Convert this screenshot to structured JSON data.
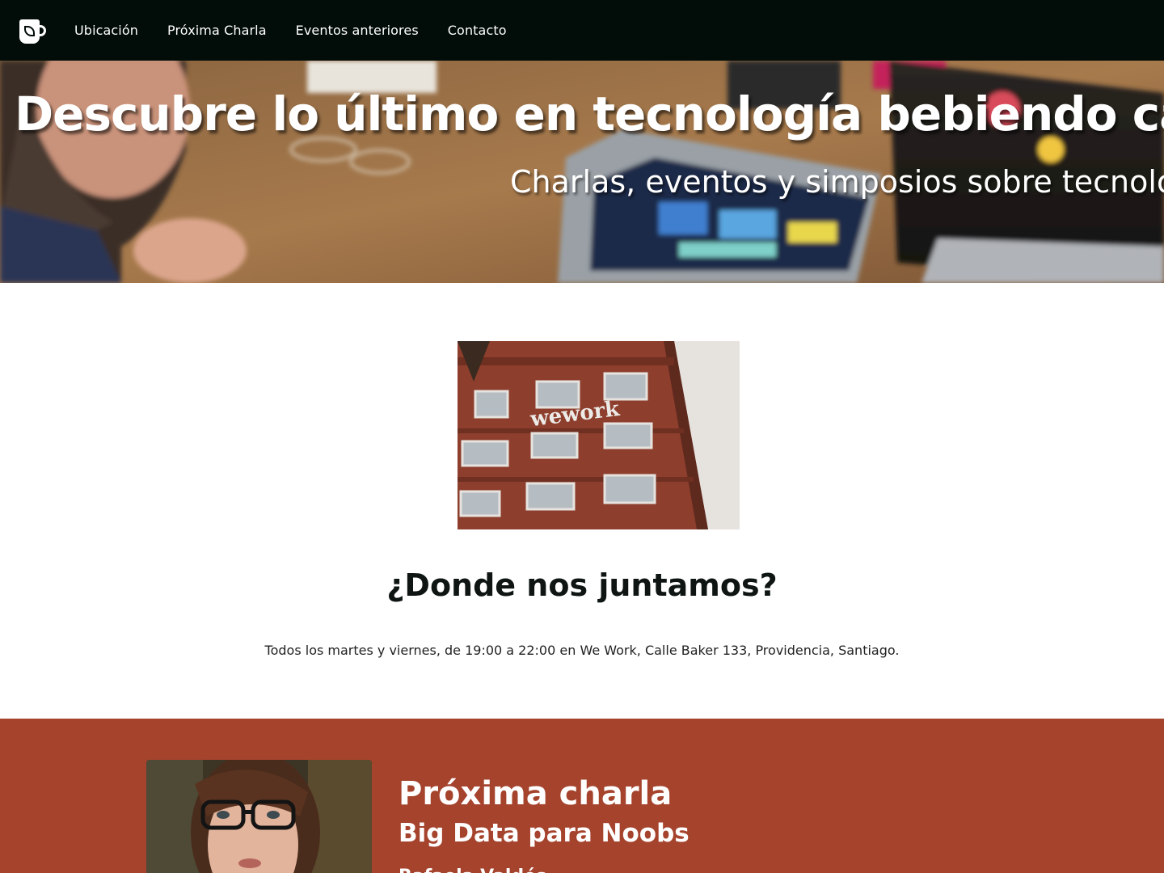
{
  "nav": {
    "logo_icon": "coffee-mug-leaf-icon",
    "links": [
      "Ubicación",
      "Próxima Charla",
      "Eventos anteriores",
      "Contacto"
    ]
  },
  "hero": {
    "title": "Descubre lo último en tecnología bebiendo café",
    "subtitle": "Charlas, eventos y simposios sobre tecnología"
  },
  "location": {
    "image_sign": "wework",
    "heading": "¿Donde nos juntamos?",
    "text": "Todos los martes y viernes, de 19:00 a 22:00 en We Work, Calle Baker 133, Providencia, Santiago."
  },
  "next_talk": {
    "heading": "Próxima charla",
    "title": "Big Data para Noobs",
    "speaker": "Rafaela Valdés"
  },
  "colors": {
    "navbar": "#020c08",
    "next_talk_bg": "#a5432d",
    "heading": "#0e1512"
  }
}
